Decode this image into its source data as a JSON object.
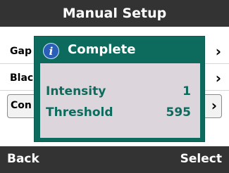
{
  "title_bar": {
    "title": "Manual Setup"
  },
  "menu": {
    "items": [
      {
        "label": "Gap",
        "chevron": "chevron-right-icon"
      },
      {
        "label": "Blac",
        "chevron": "chevron-right-icon"
      },
      {
        "label": "Con",
        "chevron": "chevron-right-icon"
      }
    ],
    "chevron_glyph": "›"
  },
  "dialog": {
    "title": "Complete",
    "icon": "info-icon",
    "icon_glyph": "i",
    "rows": [
      {
        "label": "Intensity",
        "value": "1"
      },
      {
        "label": "Threshold",
        "value": "595"
      }
    ]
  },
  "softkeys": {
    "left": "Back",
    "right": "Select"
  },
  "colors": {
    "bar_bg": "#333333",
    "dialog_teal": "#0d6b5e",
    "dialog_body": "#dcd6dc",
    "info_blue": "#2a5fb8"
  }
}
